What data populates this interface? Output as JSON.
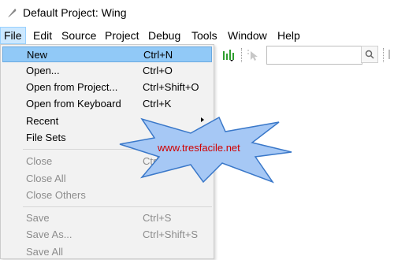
{
  "window": {
    "title": "Default Project: Wing"
  },
  "menubar": [
    "File",
    "Edit",
    "Source",
    "Project",
    "Debug",
    "Tools",
    "Window",
    "Help"
  ],
  "file_menu": {
    "items": [
      {
        "label": "New",
        "shortcut": "Ctrl+N",
        "highlighted": true,
        "disabled": false
      },
      {
        "label": "Open...",
        "shortcut": "Ctrl+O",
        "disabled": false
      },
      {
        "label": "Open from Project...",
        "shortcut": "Ctrl+Shift+O",
        "disabled": false
      },
      {
        "label": "Open from Keyboard",
        "shortcut": "Ctrl+K",
        "disabled": false
      },
      {
        "label": "Recent",
        "shortcut": "",
        "submenu": true,
        "disabled": false
      },
      {
        "label": "File Sets",
        "shortcut": "",
        "disabled": false
      },
      {
        "label": "Close",
        "shortcut": "Ctrl+W",
        "disabled": true
      },
      {
        "label": "Close All",
        "shortcut": "",
        "disabled": true
      },
      {
        "label": "Close Others",
        "shortcut": "",
        "disabled": true
      },
      {
        "label": "Save",
        "shortcut": "Ctrl+S",
        "disabled": true
      },
      {
        "label": "Save As...",
        "shortcut": "Ctrl+Shift+S",
        "disabled": true
      },
      {
        "label": "Save All",
        "shortcut": "",
        "disabled": true
      }
    ]
  },
  "toolbar": {
    "search_value": "",
    "icons": [
      "run-bars-icon",
      "cursor-icon",
      "search-icon",
      "next-icon"
    ]
  },
  "watermark": {
    "text": "www.tresfacile.net"
  },
  "colors": {
    "menu_highlight": "#91c9f7",
    "active_menu": "#cce8ff",
    "watermark_text": "#d10000",
    "star_fill": "#a6c8f5"
  }
}
